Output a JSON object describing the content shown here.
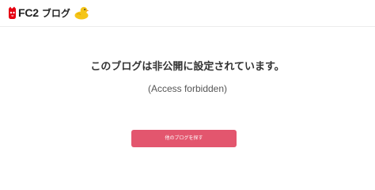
{
  "header": {
    "logo_text": "FC2",
    "service_name": "ブログ",
    "logo_icon": "fc2-cat-logo-icon",
    "mascot_icon": "duck-icon"
  },
  "main": {
    "message": "このブログは非公開に設定されています。",
    "sub_message": "(Access forbidden)",
    "button_label": "他のブログを探す"
  },
  "colors": {
    "accent": "#e3566e",
    "logo_red": "#e60012",
    "duck_yellow": "#f5c518",
    "duck_beak": "#f08a24"
  }
}
